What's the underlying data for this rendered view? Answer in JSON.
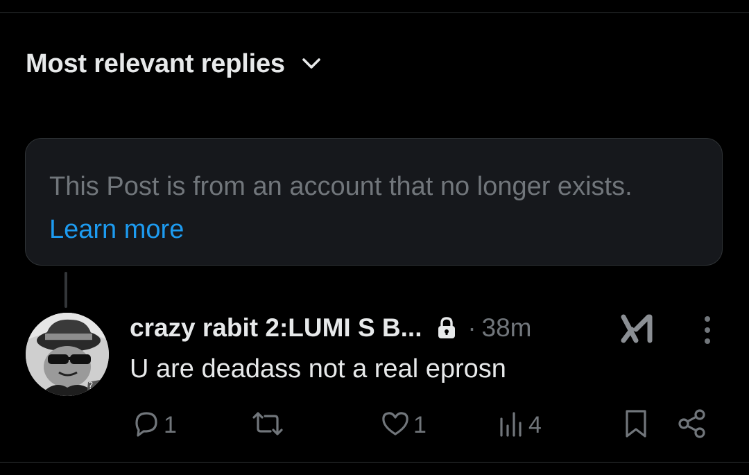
{
  "sort": {
    "label": "Most relevant replies",
    "icon": "chevron-down-icon"
  },
  "notice": {
    "text": "This Post is from an account that no longer exists.",
    "link_label": "Learn more"
  },
  "reply": {
    "author_name": "crazy rabit 2:LUMI S B...",
    "separator": "·",
    "time": "38m",
    "text": "U are deadass not a real eprosn",
    "badge_icon": "lock-icon",
    "stats": {
      "replies": "1",
      "likes": "1",
      "views": "4"
    }
  },
  "colors": {
    "background": "#000000",
    "primary_text": "#e7e9ea",
    "secondary_text": "#71767b",
    "link": "#1d9bf0",
    "card_bg": "#16181c",
    "border": "#2f3336"
  }
}
